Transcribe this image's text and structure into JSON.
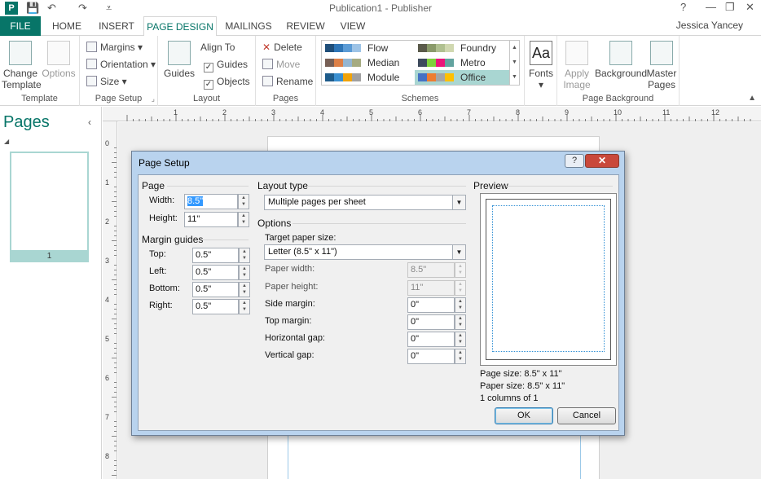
{
  "window": {
    "title": "Publication1 - Publisher",
    "app_icon": "P",
    "controls": {
      "help": "?",
      "minimize": "—",
      "restore": "❐",
      "close": "✕"
    }
  },
  "tabs": {
    "file": "FILE",
    "items": [
      "HOME",
      "INSERT",
      "PAGE DESIGN",
      "MAILINGS",
      "REVIEW",
      "VIEW"
    ],
    "active": "PAGE DESIGN",
    "user": "Jessica Yancey"
  },
  "ribbon": {
    "template": {
      "change_template": "Change Template",
      "options": "Options",
      "label": "Template"
    },
    "page_setup": {
      "margins": "Margins",
      "orientation": "Orientation",
      "size": "Size",
      "label": "Page Setup"
    },
    "layout": {
      "guides": "Guides",
      "align_to": "Align To",
      "guides_check": "Guides",
      "objects_check": "Objects",
      "label": "Layout"
    },
    "pages": {
      "delete": "Delete",
      "move": "Move",
      "rename": "Rename",
      "label": "Pages"
    },
    "schemes": {
      "label": "Schemes",
      "items": [
        {
          "name": "Flow",
          "colors": [
            "#1f4e79",
            "#2e75b6",
            "#5b9bd5",
            "#9dc3e6"
          ]
        },
        {
          "name": "Foundry",
          "colors": [
            "#5a5a4a",
            "#8a9a6a",
            "#b0c090",
            "#d0d8b0"
          ]
        },
        {
          "name": "Median",
          "colors": [
            "#775f55",
            "#dd8047",
            "#94b6d2",
            "#a5ab81"
          ]
        },
        {
          "name": "Metro",
          "colors": [
            "#3d4a5c",
            "#7fd13b",
            "#ea157a",
            "#62a39f"
          ]
        },
        {
          "name": "Module",
          "colors": [
            "#1e5b8a",
            "#3a8fd0",
            "#f0a30a",
            "#a0a0a0"
          ]
        },
        {
          "name": "Office",
          "colors": [
            "#4472c4",
            "#ed7d31",
            "#a5a5a5",
            "#ffc000"
          ]
        }
      ],
      "selected": "Office"
    },
    "fonts": {
      "icon_text": "Aa",
      "label": "Fonts"
    },
    "page_background": {
      "apply_image": "Apply Image",
      "background": "Background",
      "master_pages": "Master Pages",
      "label": "Page Background"
    }
  },
  "pages_panel": {
    "title": "Pages",
    "thumb_number": "1"
  },
  "ruler": {
    "h_labels": [
      "1",
      "2",
      "3",
      "4",
      "5",
      "6",
      "7",
      "8",
      "9",
      "10",
      "11",
      "12"
    ],
    "v_labels": [
      "0",
      "1",
      "2",
      "3",
      "4",
      "5",
      "6",
      "7",
      "8"
    ]
  },
  "dialog": {
    "title": "Page Setup",
    "page": {
      "heading": "Page",
      "width_label": "Width:",
      "width_value": "8.5\"",
      "height_label": "Height:",
      "height_value": "11\""
    },
    "margins": {
      "heading": "Margin guides",
      "top_label": "Top:",
      "top_value": "0.5\"",
      "left_label": "Left:",
      "left_value": "0.5\"",
      "bottom_label": "Bottom:",
      "bottom_value": "0.5\"",
      "right_label": "Right:",
      "right_value": "0.5\""
    },
    "layout_type": {
      "heading": "Layout type",
      "value": "Multiple pages per sheet"
    },
    "options": {
      "heading": "Options",
      "target_label": "Target paper size:",
      "target_value": "Letter (8.5\" x 11\")",
      "paper_width_label": "Paper width:",
      "paper_width_value": "8.5\"",
      "paper_height_label": "Paper height:",
      "paper_height_value": "11\"",
      "side_margin_label": "Side margin:",
      "side_margin_value": "0\"",
      "top_margin_label": "Top margin:",
      "top_margin_value": "0\"",
      "h_gap_label": "Horizontal gap:",
      "h_gap_value": "0\"",
      "v_gap_label": "Vertical gap:",
      "v_gap_value": "0\""
    },
    "preview": {
      "heading": "Preview",
      "page_size": "Page size: 8.5\" x 11\"",
      "paper_size": "Paper size: 8.5\" x 11\"",
      "columns": "1 columns of 1"
    },
    "buttons": {
      "ok": "OK",
      "cancel": "Cancel"
    }
  }
}
